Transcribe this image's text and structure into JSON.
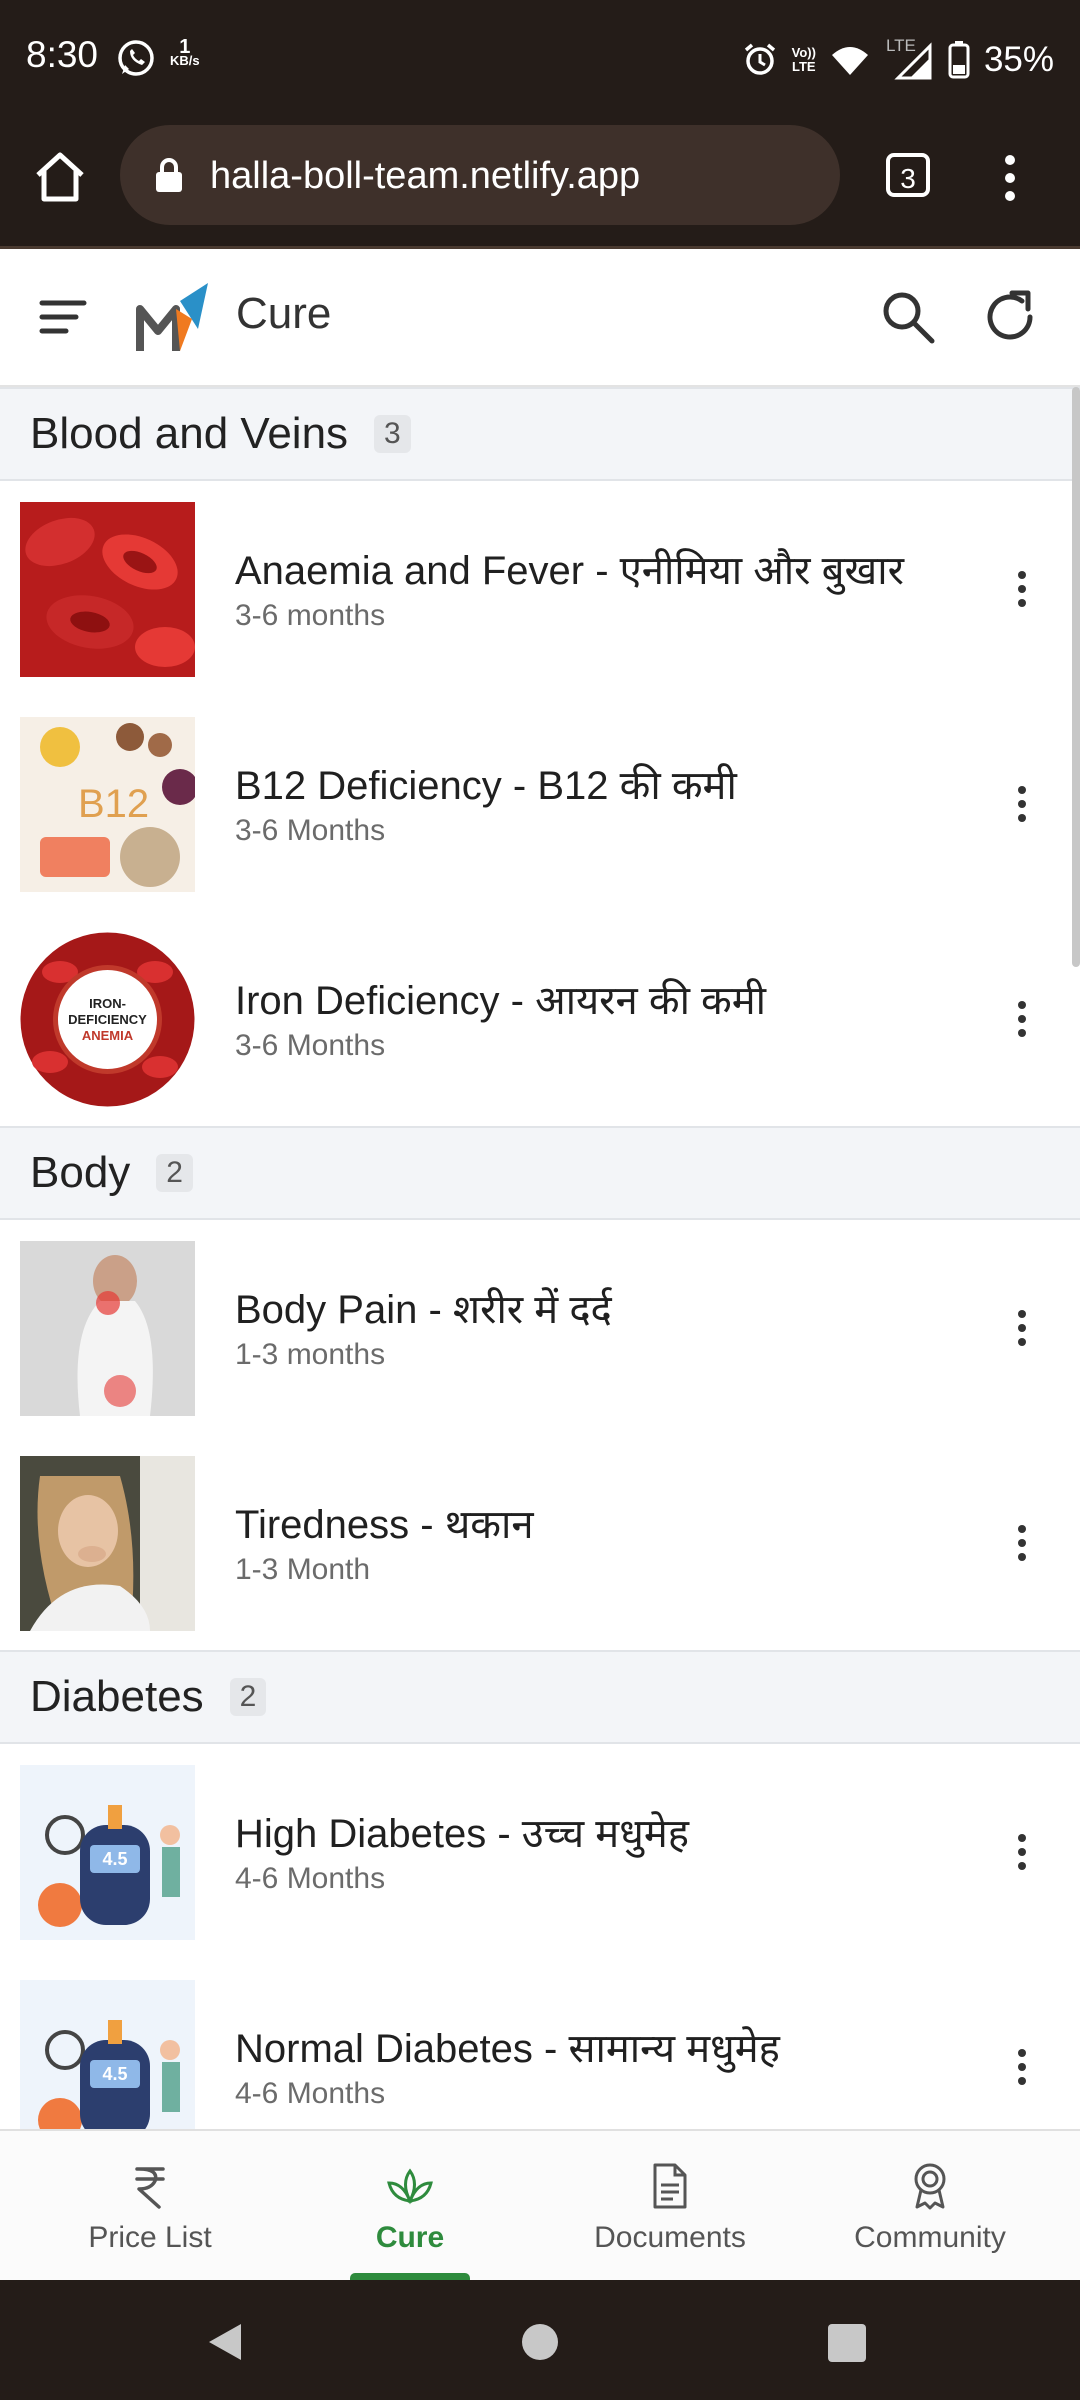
{
  "status_bar": {
    "time": "8:30",
    "speed_value": "1",
    "speed_unit": "KB/s",
    "volte_line1": "Vo))",
    "volte_line2": "LTE",
    "lte": "LTE",
    "battery": "35%"
  },
  "browser": {
    "url": "halla-boll-team.netlify.app",
    "tab_count": "3"
  },
  "header": {
    "title": "Cure"
  },
  "sections": [
    {
      "title": "Blood and Veins",
      "count": "3",
      "items": [
        {
          "title": "Anaemia and Fever - एनीमिया और बुखार",
          "duration": "3-6 months"
        },
        {
          "title": "B12 Deficiency - B12 की कमी",
          "duration": "3-6 Months"
        },
        {
          "title": "Iron Deficiency - आयरन की कमी",
          "duration": "3-6 Months"
        }
      ]
    },
    {
      "title": "Body",
      "count": "2",
      "items": [
        {
          "title": "Body Pain - शरीर में दर्द",
          "duration": "1-3 months"
        },
        {
          "title": "Tiredness - थकान",
          "duration": "1-3 Month"
        }
      ]
    },
    {
      "title": "Diabetes",
      "count": "2",
      "items": [
        {
          "title": "High Diabetes - उच्च मधुमेह",
          "duration": "4-6 Months"
        },
        {
          "title": "Normal Diabetes - सामान्य मधुमेह",
          "duration": "4-6 Months"
        }
      ]
    }
  ],
  "thumb_text": {
    "b12": "B12",
    "iron_line1": "IRON-",
    "iron_line2": "DEFICIENCY",
    "iron_line3": "ANEMIA",
    "glucose": "4.5"
  },
  "bottom_nav": [
    {
      "label": "Price List",
      "icon": "rupee-icon"
    },
    {
      "label": "Cure",
      "icon": "lotus-icon",
      "active": true
    },
    {
      "label": "Documents",
      "icon": "document-icon"
    },
    {
      "label": "Community",
      "icon": "award-icon"
    }
  ],
  "colors": {
    "accent": "#2e8b3d",
    "chrome": "#241c18"
  }
}
